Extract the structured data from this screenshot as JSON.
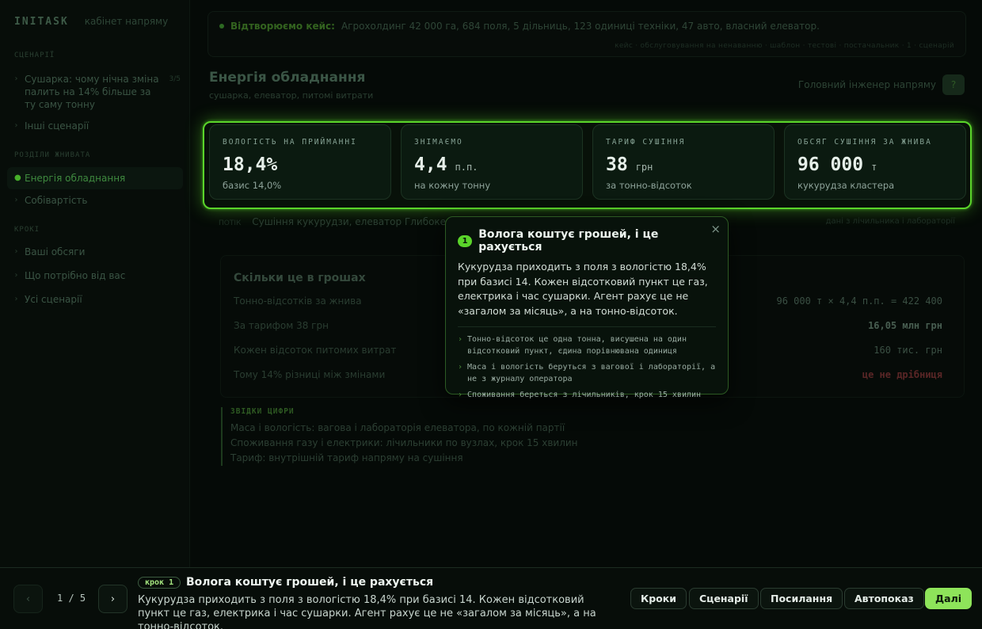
{
  "brand": {
    "logo": "INITASK",
    "subtitle": "кабінет напряму"
  },
  "sidebar": {
    "sections": [
      "СЦЕНАРІЇ",
      "РОЗДІЛИ ЖНИВАТА",
      "КРОКІ"
    ],
    "scenario_items": [
      {
        "label": "Сушарка: чому нічна зміна палить на 14% більше за ту саму тонну",
        "count": "3/5"
      },
      {
        "label": "Інші сценарії",
        "count": ""
      }
    ],
    "section_items": [
      {
        "label": "Енергія обладнання",
        "active": true
      },
      {
        "label": "Собівартість",
        "active": false
      }
    ],
    "step_items": [
      {
        "label": "Ваші обсяги"
      },
      {
        "label": "Що потрібно від вас"
      },
      {
        "label": "Усі сценарії"
      }
    ]
  },
  "scenario": {
    "label": "Відтворюємо кейс:",
    "text": "Агрохолдинг 42 000 га, 684 поля, 5 дільниць, 123 одиниці техніки, 47 авто, власний елеватор.",
    "meta": "кейс · обслуговування на ненаванню · шаблон · тестові · постачальник · 1 · сценарій"
  },
  "page": {
    "title": "Енергія обладнання",
    "subtitle": "сушарка, елеватор, питомі витрати",
    "right_text": "Головний інженер напряму",
    "right_button": "?"
  },
  "kpis": [
    {
      "label": "ВОЛОГІСТЬ НА ПРИЙМАННІ",
      "value": "18,4%",
      "unit": "",
      "note": "базис 14,0%"
    },
    {
      "label": "ЗНІМАЄМО",
      "value": "4,4",
      "unit": "п.п.",
      "note": "на кожну тонну"
    },
    {
      "label": "ТАРИФ СУШІННЯ",
      "value": "38",
      "unit": "грн",
      "note": "за тонно-відсоток"
    },
    {
      "label": "ОБСЯГ СУШІННЯ ЗА ЖНИВА",
      "value": "96 000",
      "unit": "т",
      "note": "кукурудза кластера"
    }
  ],
  "line_row": {
    "prefix": "ПОТІК",
    "text": "Сушіння кукурудзи, елеватор Глибоке",
    "right": "дані з лічильника і лабораторії"
  },
  "calc": {
    "title": "Скільки це в грошах",
    "rows": [
      {
        "label": "Тонно-відсотків за жнива",
        "value": "96 000 т × 4,4 п.п. = 422 400",
        "style": ""
      },
      {
        "label": "За тарифом 38 грн",
        "value": "16,05 млн грн",
        "style": "bold"
      },
      {
        "label": "Кожен відсоток питомих витрат",
        "value": "160 тис. грн",
        "style": ""
      },
      {
        "label": "Тому 14% різниці між змінами",
        "value": "це не дрібниця",
        "style": "red"
      }
    ]
  },
  "sources": {
    "head": "ЗВІДКИ ЦИФРИ",
    "lines": [
      "Маса і вологість: вагова і лабораторія елеватора, по кожній партії",
      "Споживання газу і електрики: лічильники по вузлах, крок 15 хвилин",
      "Тариф: внутрішній тариф напряму на сушіння"
    ]
  },
  "tooltip": {
    "step": "1",
    "title": "Волога коштує грошей, і це рахується",
    "close": "×",
    "body": "Кукурудза приходить з поля з вологістю 18,4% при базисі 14. Кожен відсотковий пункт це газ, електрика і час сушарки. Агент рахує це не «загалом за місяць», а на тонно-відсоток.",
    "bullets": [
      "Тонно-відсоток це одна тонна, висушена на один відсотковий пункт, єдина порівнювана одиниця",
      "Маса і вологість беруться з вагової і лабораторії, а не з журналу оператора",
      "Споживання береться з лічильників, крок 15 хвилин"
    ]
  },
  "bottom": {
    "prev": "‹",
    "next": "›",
    "pager": "1 / 5",
    "step_badge": "крок 1",
    "step_title": "Волога коштує грошей, і це рахується",
    "step_desc": "Кукурудза приходить з поля з вологістю 18,4% при базисі 14. Кожен відсотковий пункт це газ, електрика і час сушарки. Агент рахує це не «загалом за місяць», а на тонно-відсоток.",
    "buttons": [
      "Кроки",
      "Сценарії",
      "Посилання",
      "Автопоказ",
      "Далі"
    ]
  },
  "colors": {
    "accent": "#5ad42a",
    "primary_button": "#8ee45a",
    "background": "#050a07"
  }
}
